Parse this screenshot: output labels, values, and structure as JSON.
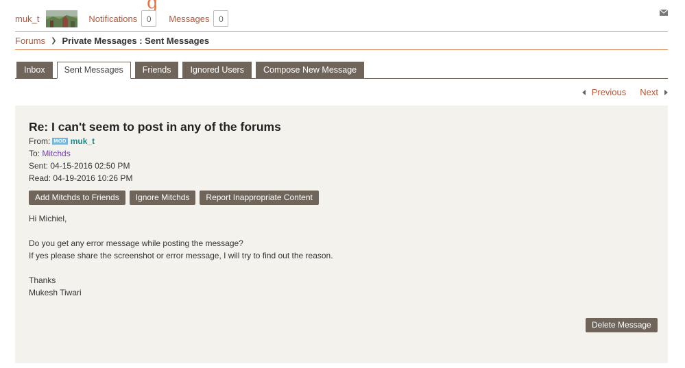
{
  "topbar": {
    "username": "muk_t",
    "notifications_label": "Notifications",
    "notifications_count": "0",
    "messages_label": "Messages",
    "messages_count": "0",
    "mail_icon": "envelope-icon"
  },
  "breadcrumb": {
    "forums": "Forums",
    "current": "Private Messages : Sent Messages"
  },
  "tabs": [
    {
      "label": "Inbox",
      "active": false
    },
    {
      "label": "Sent Messages",
      "active": true
    },
    {
      "label": "Friends",
      "active": false
    },
    {
      "label": "Ignored Users",
      "active": false
    },
    {
      "label": "Compose New Message",
      "active": false
    }
  ],
  "pager": {
    "previous": "Previous",
    "next": "Next"
  },
  "message": {
    "subject": "Re: I can't seem to post in any of the forums",
    "from_label": "From:",
    "mod_badge": "MOD",
    "from_user": "muk_t",
    "to_label": "To:",
    "to_user": "Mitchds",
    "sent": "Sent: 04-15-2016 02:50 PM",
    "read": "Read: 04-19-2016 10:26 PM",
    "body": [
      "Hi Michiel,",
      "",
      "Do you get any error message while posting the message?",
      "If yes please share the screenshot or error message, I will try to find out the reason.",
      "",
      "Thanks",
      "Mukesh Tiwari"
    ]
  },
  "actions": {
    "add_friend": "Add Mitchds to Friends",
    "ignore": "Ignore Mitchds",
    "report": "Report Inappropriate Content",
    "delete": "Delete Message"
  },
  "colors": {
    "accent": "#b5573a",
    "rule": "#e08a5c",
    "button": "#6f655b",
    "panel": "#f4f2ec",
    "mod_badge": "#7ab3d8",
    "from_user": "#1a8a8e",
    "to_user": "#7a3fb6"
  }
}
